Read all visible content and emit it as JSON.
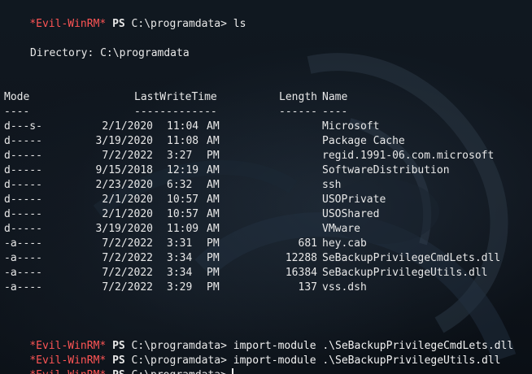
{
  "prompt": {
    "star": "*",
    "name": "Evil-WinRM*",
    "ps": "PS",
    "path": "C:\\programdata>"
  },
  "commands": [
    "ls",
    "import-module .\\SeBackupPrivilegeCmdLets.dll",
    "import-module .\\SeBackupPrivilegeUtils.dll",
    ""
  ],
  "directory_line": "Directory: C:\\programdata",
  "headers": {
    "mode": "Mode",
    "lastwritetime": "LastWriteTime",
    "length": "Length",
    "name": "Name"
  },
  "underlines": {
    "mode": "----",
    "lastwritetime": "-------------",
    "length": "------",
    "name": "----"
  },
  "rows": [
    {
      "mode": "d---s-",
      "date": "2/1/2020",
      "time": "11:04",
      "ampm": "AM",
      "length": "",
      "name": "Microsoft"
    },
    {
      "mode": "d-----",
      "date": "3/19/2020",
      "time": "11:08",
      "ampm": "AM",
      "length": "",
      "name": "Package Cache"
    },
    {
      "mode": "d-----",
      "date": "7/2/2022",
      "time": "3:27",
      "ampm": "PM",
      "length": "",
      "name": "regid.1991-06.com.microsoft"
    },
    {
      "mode": "d-----",
      "date": "9/15/2018",
      "time": "12:19",
      "ampm": "AM",
      "length": "",
      "name": "SoftwareDistribution"
    },
    {
      "mode": "d-----",
      "date": "2/23/2020",
      "time": "6:32",
      "ampm": "AM",
      "length": "",
      "name": "ssh"
    },
    {
      "mode": "d-----",
      "date": "2/1/2020",
      "time": "10:57",
      "ampm": "AM",
      "length": "",
      "name": "USOPrivate"
    },
    {
      "mode": "d-----",
      "date": "2/1/2020",
      "time": "10:57",
      "ampm": "AM",
      "length": "",
      "name": "USOShared"
    },
    {
      "mode": "d-----",
      "date": "3/19/2020",
      "time": "11:09",
      "ampm": "AM",
      "length": "",
      "name": "VMware"
    },
    {
      "mode": "-a----",
      "date": "7/2/2022",
      "time": "3:31",
      "ampm": "PM",
      "length": "681",
      "name": "hey.cab"
    },
    {
      "mode": "-a----",
      "date": "7/2/2022",
      "time": "3:34",
      "ampm": "PM",
      "length": "12288",
      "name": "SeBackupPrivilegeCmdLets.dll"
    },
    {
      "mode": "-a----",
      "date": "7/2/2022",
      "time": "3:34",
      "ampm": "PM",
      "length": "16384",
      "name": "SeBackupPrivilegeUtils.dll"
    },
    {
      "mode": "-a----",
      "date": "7/2/2022",
      "time": "3:29",
      "ampm": "PM",
      "length": "137",
      "name": "vss.dsh"
    }
  ],
  "colors": {
    "background": "#0d1117",
    "prompt_red": "#ff5555",
    "text": "#e8e8e8"
  }
}
